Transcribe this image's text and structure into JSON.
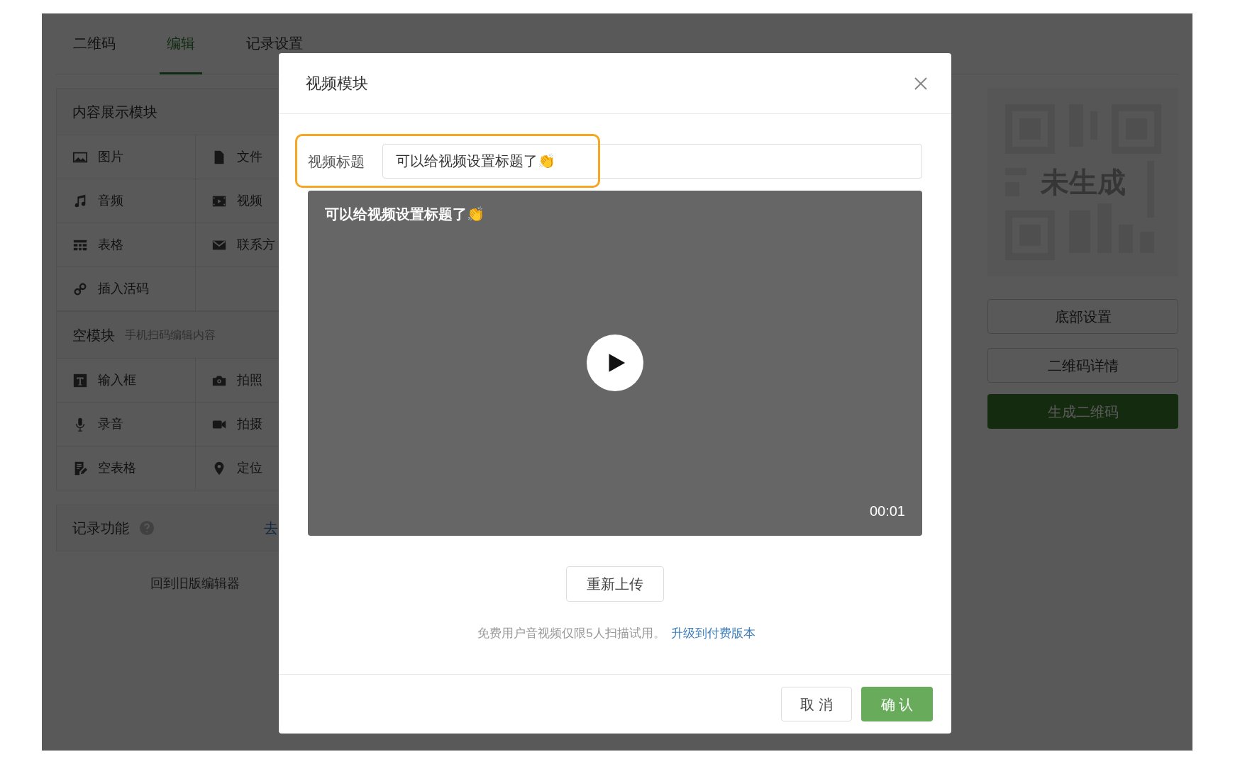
{
  "tabs": [
    {
      "label": "二维码",
      "selected": false
    },
    {
      "label": "编辑",
      "selected": true
    },
    {
      "label": "记录设置",
      "selected": false
    }
  ],
  "content_modules": {
    "title": "内容展示模块",
    "items": [
      "图片",
      "文件",
      "音频",
      "视频",
      "表格",
      "联系方",
      "插入活码"
    ]
  },
  "empty_modules": {
    "title": "空模块",
    "hint": "手机扫码编辑内容",
    "items": [
      "输入框",
      "拍照",
      "录音",
      "拍摄",
      "空表格",
      "定位"
    ]
  },
  "record": {
    "title": "记录功能",
    "link": "去"
  },
  "old_editor_link": "回到旧版编辑器",
  "qr_preview": {
    "status": "未生成"
  },
  "side_buttons": [
    {
      "label": "底部设置",
      "kind": "outline"
    },
    {
      "label": "二维码详情",
      "kind": "outline"
    },
    {
      "label": "生成二维码",
      "kind": "primary"
    }
  ],
  "modal": {
    "title": "视频模块",
    "title_field": {
      "label": "视频标题",
      "value": "可以给视频设置标题了👏",
      "highlighted": true
    },
    "video": {
      "title": "可以给视频设置标题了👏",
      "duration": "00:01"
    },
    "reupload_button": "重新上传",
    "notice": {
      "text": "免费用户音视频仅限5人扫描试用。",
      "link": "升级到付费版本"
    },
    "buttons": [
      {
        "label": "取 消",
        "kind": "default"
      },
      {
        "label": "确 认",
        "kind": "primary"
      }
    ]
  }
}
